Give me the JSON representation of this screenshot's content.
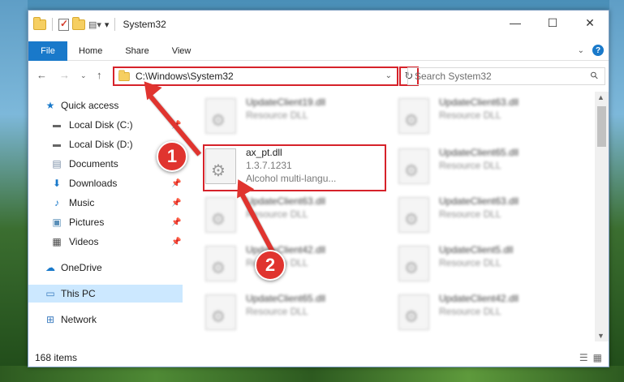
{
  "window": {
    "title": "System32"
  },
  "controls": {
    "minimize": "—",
    "maximize": "☐",
    "close": "✕"
  },
  "ribbon": {
    "tabs": [
      "File",
      "Home",
      "Share",
      "View"
    ]
  },
  "address": {
    "path": "C:\\Windows\\System32",
    "search_placeholder": "Search System32"
  },
  "sidebar": {
    "items": [
      {
        "label": "Quick access",
        "icon": "star-icon"
      },
      {
        "label": "Local Disk (C:)",
        "icon": "drive-icon"
      },
      {
        "label": "Local Disk (D:)",
        "icon": "drive-icon"
      },
      {
        "label": "Documents",
        "icon": "documents-icon"
      },
      {
        "label": "Downloads",
        "icon": "download-icon"
      },
      {
        "label": "Music",
        "icon": "music-icon"
      },
      {
        "label": "Pictures",
        "icon": "pictures-icon"
      },
      {
        "label": "Videos",
        "icon": "videos-icon"
      },
      {
        "label": "OneDrive",
        "icon": "cloud-icon"
      },
      {
        "label": "This PC",
        "icon": "computer-icon"
      },
      {
        "label": "Network",
        "icon": "network-icon"
      }
    ]
  },
  "files": [
    {
      "name": "UpdateClient19.dll",
      "sub": "Resource DLL"
    },
    {
      "name": "UpdateClient63.dll",
      "sub": "Resource DLL"
    },
    {
      "name": "ax_pt.dll",
      "sub": "1.3.7.1231",
      "sub2": "Alcohol multi-langu..."
    },
    {
      "name": "UpdateClient65.dll",
      "sub": "Resource DLL"
    },
    {
      "name": "UpdateClient63.dll",
      "sub": "Resource DLL"
    },
    {
      "name": "UpdateClient63.dll",
      "sub": "Resource DLL"
    },
    {
      "name": "UpdateClient42.dll",
      "sub": "Resource DLL"
    },
    {
      "name": "UpdateClient5.dll",
      "sub": "Resource DLL"
    },
    {
      "name": "UpdateClient65.dll",
      "sub": "Resource DLL"
    },
    {
      "name": "UpdateClient42.dll",
      "sub": "Resource DLL"
    }
  ],
  "status": {
    "count": "168 items"
  },
  "callouts": {
    "one": "1",
    "two": "2"
  },
  "colors": {
    "accent": "#1979ca",
    "highlight": "#d6222a",
    "selected": "#cce8ff"
  }
}
